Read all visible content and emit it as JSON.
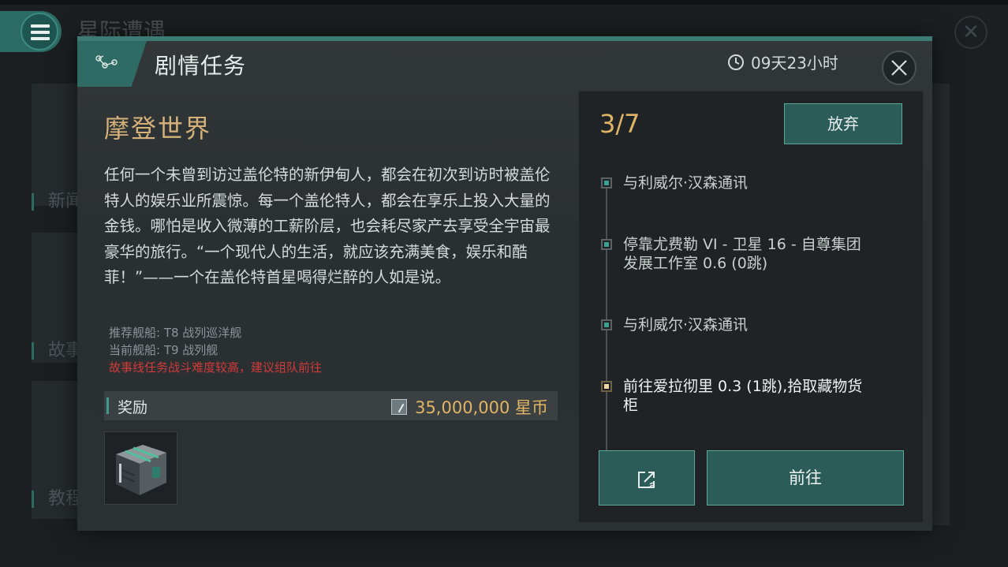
{
  "background": {
    "app_title": "星际遭遇",
    "side_labels": [
      "新闻",
      "故事",
      "教程"
    ],
    "menu_icon": "hamburger-menu-icon",
    "close_icon": "close-icon"
  },
  "dialog": {
    "header_icon": "storyline-nodes-icon",
    "title": "剧情任务",
    "timer_icon": "clock-icon",
    "time_remaining": "09天23小时",
    "close_icon": "close-icon"
  },
  "mission": {
    "name": "摩登世界",
    "description": "任何一个未曾到访过盖伦特的新伊甸人，都会在初次到访时被盖伦特人的娱乐业所震惊。每一个盖伦特人，都会在享乐上投入大量的金钱。哪怕是收入微薄的工薪阶层，也会耗尽家产去享受全宇宙最豪华的旅行。“一个现代人的生活，就应该充满美食，娱乐和酷菲！”——一个在盖伦特首星喝得烂醉的人如是说。",
    "recommended_ship": "推荐舰船: T8 战列巡洋舰",
    "current_ship": "当前舰船: T9 战列舰",
    "warning": "故事线任务战斗难度较高，建议组队前往"
  },
  "reward": {
    "label": "奖励",
    "currency_icon": "star-coin-icon",
    "amount": "35,000,000 星币",
    "item_icon": "cargo-container-icon"
  },
  "progress": {
    "text": "3/7",
    "abandon_label": "放弃",
    "steps": [
      {
        "text": "与利威尔·汉森通讯"
      },
      {
        "text": "停靠尤费勒 VI - 卫星 16 - 自尊集团 发展工作室 0.6 (0跳)"
      },
      {
        "text": "与利威尔·汉森通讯"
      },
      {
        "text": "前往爱拉彻里 0.3 (1跳),拾取藏物货柜"
      }
    ],
    "share_icon": "share-icon",
    "go_label": "前往"
  },
  "colors": {
    "accent": "#3c7a73",
    "gold": "#d6b27a",
    "warning": "#d23a3a"
  }
}
